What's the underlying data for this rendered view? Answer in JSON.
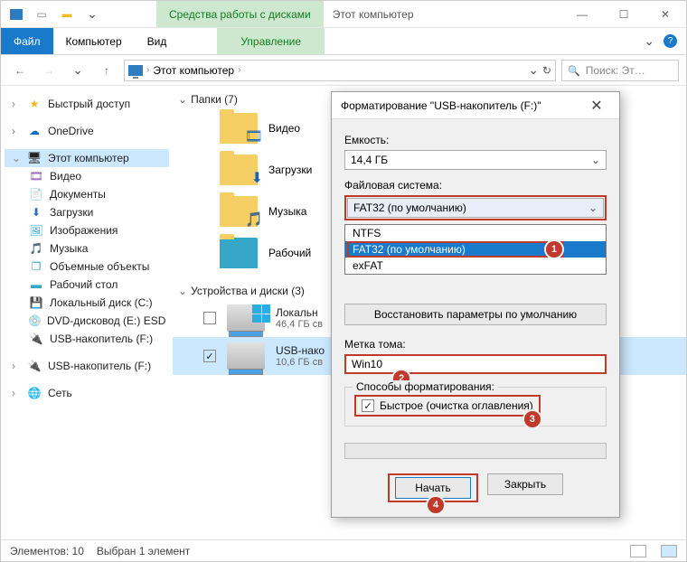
{
  "titlebar": {
    "ribbon_context_tab": "Средства работы с дисками",
    "window_title": "Этот компьютер"
  },
  "ribbon": {
    "file": "Файл",
    "computer": "Компьютер",
    "view": "Вид",
    "manage": "Управление"
  },
  "address": {
    "path_label": "Этот компьютер",
    "search_placeholder": "Поиск: Эт…"
  },
  "sidebar": {
    "quick_access": "Быстрый доступ",
    "onedrive": "OneDrive",
    "this_pc": "Этот компьютер",
    "videos": "Видео",
    "documents": "Документы",
    "downloads": "Загрузки",
    "pictures": "Изображения",
    "music": "Музыка",
    "objects3d": "Объемные объекты",
    "desktop": "Рабочий стол",
    "local_disk": "Локальный диск (C:)",
    "dvd": "DVD-дисковод (E:) ESD",
    "usb1": "USB-накопитель (F:)",
    "usb2": "USB-накопитель (F:)",
    "network": "Сеть"
  },
  "content": {
    "folders_header": "Папки (7)",
    "videos": "Видео",
    "downloads": "Загрузки",
    "music": "Музыка",
    "desktop": "Рабочий",
    "devices_header": "Устройства и диски (3)",
    "local_disk_label": "Локальн",
    "local_disk_meta": "46,4 ГБ св",
    "usb_label": "USB-нако",
    "usb_meta": "10,6 ГБ св"
  },
  "status": {
    "count": "Элементов: 10",
    "selection": "Выбран 1 элемент"
  },
  "dialog": {
    "title": "Форматирование \"USB-накопитель (F:)\"",
    "capacity_label": "Емкость:",
    "capacity_value": "14,4 ГБ",
    "filesystem_label": "Файловая система:",
    "filesystem_value": "FAT32 (по умолчанию)",
    "fs_options": {
      "ntfs": "NTFS",
      "fat32": "FAT32 (по умолчанию)",
      "exfat": "exFAT"
    },
    "restore_defaults": "Восстановить параметры по умолчанию",
    "volume_label_label": "Метка тома:",
    "volume_label_value": "Win10",
    "methods_legend": "Способы форматирования:",
    "quick_format": "Быстрое (очистка оглавления)",
    "start": "Начать",
    "close": "Закрыть"
  },
  "annotations": {
    "a1": "1",
    "a2": "2",
    "a3": "3",
    "a4": "4"
  }
}
